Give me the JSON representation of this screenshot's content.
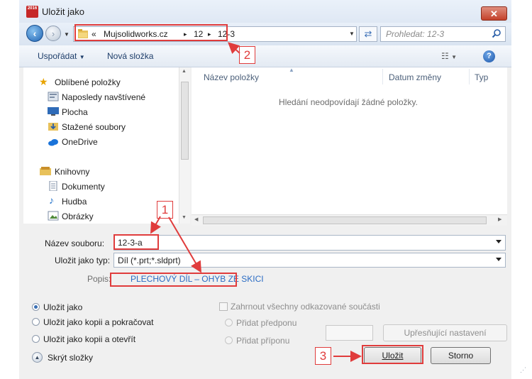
{
  "window": {
    "title": "Uložit jako",
    "close_glyph": "✕",
    "app_icon_text": "2016"
  },
  "address_bar": {
    "overflow_glyph": "«",
    "breadcrumbs": [
      "Mujsolidworks.cz",
      "12",
      "12-3"
    ],
    "separator_glyph": "▸",
    "search_placeholder": "Prohledat: 12-3"
  },
  "toolbar": {
    "organize_label": "Uspořádat",
    "new_folder_label": "Nová složka",
    "help_glyph": "?"
  },
  "nav_pane": {
    "favorites_header": "Oblíbené položky",
    "favorites": [
      "Naposledy navštívené",
      "Plocha",
      "Stažené soubory",
      "OneDrive"
    ],
    "libraries_header": "Knihovny",
    "libraries": [
      "Dokumenty",
      "Hudba",
      "Obrázky"
    ]
  },
  "file_list": {
    "columns": [
      "Název položky",
      "Datum změny",
      "Typ"
    ],
    "empty_message": "Hledání neodpovídají žádné položky."
  },
  "form": {
    "filename_label": "Název souboru:",
    "filename_value": "12-3-a",
    "filetype_label": "Uložit jako typ:",
    "filetype_value": "Díl (*.prt;*.sldprt)",
    "description_label": "Popis:",
    "description_value": "PLECHOVÝ DÍL – OHYB ZE SKICI"
  },
  "options": {
    "save_as": "Uložit jako",
    "save_copy_continue": "Uložit jako kopii a pokračovat",
    "save_copy_open": "Uložit jako kopii a otevřít",
    "include_refs": "Zahrnout všechny odkazované součásti",
    "add_prefix": "Přidat předponu",
    "add_suffix": "Přidat příponu",
    "advanced": "Upřesňující nastavení",
    "hide_folders": "Skrýt složky"
  },
  "buttons": {
    "save": "Uložit",
    "cancel": "Storno"
  },
  "annotations": {
    "callout_1": "1",
    "callout_2": "2",
    "callout_3": "3"
  },
  "colors": {
    "annotation_red": "#e03c3c",
    "link_blue": "#2b6cc4"
  }
}
